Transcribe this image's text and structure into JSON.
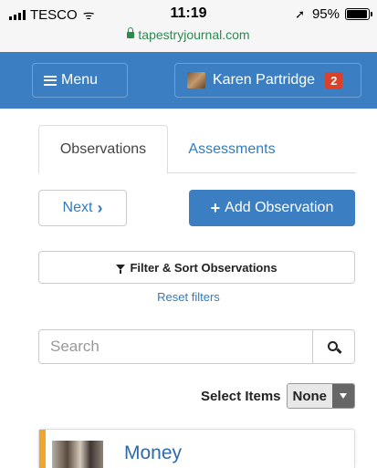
{
  "status_bar": {
    "carrier": "TESCO",
    "time": "11:19",
    "url": "tapestryjournal.com",
    "battery": "95%",
    "battery_level": 0.95
  },
  "header": {
    "menu_label": "Menu",
    "user_name": "Karen Partridge",
    "notification_count": "2"
  },
  "tabs": [
    {
      "label": "Observations",
      "active": true
    },
    {
      "label": "Assessments",
      "active": false
    }
  ],
  "actions": {
    "next_label": "Next",
    "add_label": "Add Observation"
  },
  "filter": {
    "label": "Filter & Sort Observations",
    "reset_label": "Reset filters"
  },
  "search": {
    "placeholder": "Search"
  },
  "select_items": {
    "label": "Select Items",
    "value": "None"
  },
  "observation": {
    "title": "Money"
  },
  "colors": {
    "header_blue": "#3b7fc2",
    "link_blue": "#2f7cc1",
    "badge_red": "#d9412b",
    "card_accent": "#f0a62c"
  }
}
